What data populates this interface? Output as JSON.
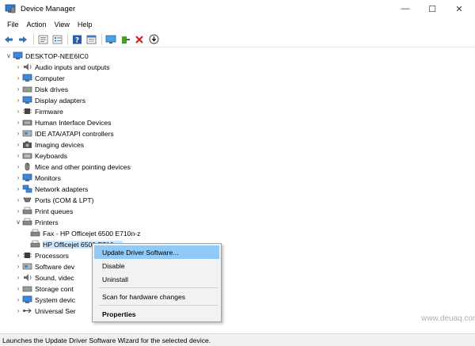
{
  "window": {
    "title": "Device Manager",
    "minimize": "—",
    "maximize": "☐",
    "close": "✕"
  },
  "menu": [
    "File",
    "Action",
    "View",
    "Help"
  ],
  "toolbar_icons": [
    "back-arrow-icon",
    "forward-arrow-icon",
    "properties-icon",
    "list-icon",
    "help-icon",
    "properties-sheet-icon",
    "monitor-icon",
    "enable-driver-icon",
    "uninstall-x-icon",
    "update-driver-icon"
  ],
  "tree": {
    "root": "DESKTOP-NEE6IC0",
    "categories": [
      "Audio inputs and outputs",
      "Computer",
      "Disk drives",
      "Display adapters",
      "Firmware",
      "Human Interface Devices",
      "IDE ATA/ATAPI controllers",
      "Imaging devices",
      "Keyboards",
      "Mice and other pointing devices",
      "Monitors",
      "Network adapters",
      "Ports (COM & LPT)",
      "Print queues",
      "Printers"
    ],
    "printers_children": [
      "Fax - HP Officejet 6500 E710n-z",
      "HP Officejet 6500 E710n-z"
    ],
    "after_categories": [
      "Processors",
      "Software dev",
      "Sound, videc",
      "Storage cont",
      "System devic",
      "Universal Ser"
    ]
  },
  "context_menu": {
    "update": "Update Driver Software...",
    "disable": "Disable",
    "uninstall": "Uninstall",
    "scan": "Scan for hardware changes",
    "properties": "Properties"
  },
  "status": "Launches the Update Driver Software Wizard for the selected device.",
  "watermark": "www.deuaq.com",
  "colors": {
    "selection": "#cde8ff",
    "menu_highlight": "#91c9f7"
  }
}
